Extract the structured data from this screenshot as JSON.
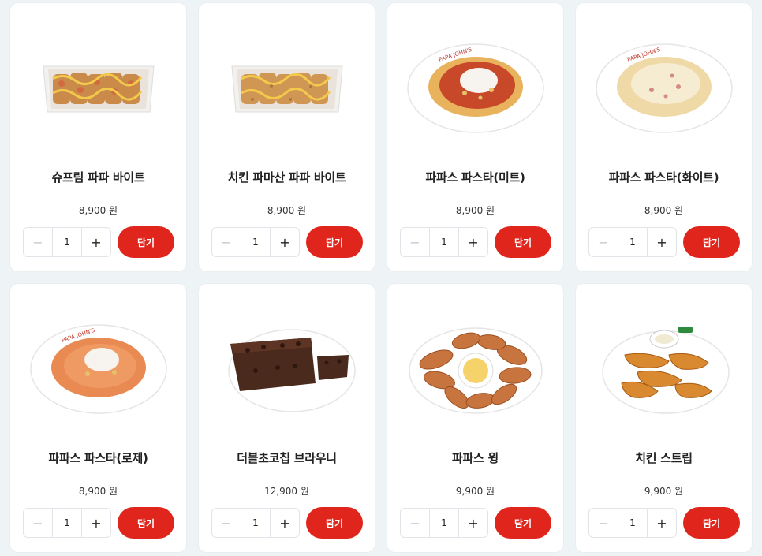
{
  "products": [
    {
      "name": "슈프림 파파 바이트",
      "price": "8,900 원",
      "qty": "1",
      "minus": "−",
      "plus": "+",
      "add_label": "담기",
      "image": "supreme-bite-tray"
    },
    {
      "name": "치킨 파마산 파파 바이트",
      "price": "8,900 원",
      "qty": "1",
      "minus": "−",
      "plus": "+",
      "add_label": "담기",
      "image": "chicken-parmesan-bite-tray"
    },
    {
      "name": "파파스 파스타(미트)",
      "price": "8,900 원",
      "qty": "1",
      "minus": "−",
      "plus": "+",
      "add_label": "담기",
      "image": "meat-pasta-plate"
    },
    {
      "name": "파파스 파스타(화이트)",
      "price": "8,900 원",
      "qty": "1",
      "minus": "−",
      "plus": "+",
      "add_label": "담기",
      "image": "white-pasta-plate"
    },
    {
      "name": "파파스 파스타(로제)",
      "price": "8,900 원",
      "qty": "1",
      "minus": "−",
      "plus": "+",
      "add_label": "담기",
      "image": "rose-pasta-plate"
    },
    {
      "name": "더블초코칩 브라우니",
      "price": "12,900 원",
      "qty": "1",
      "minus": "−",
      "plus": "+",
      "add_label": "담기",
      "image": "brownie-plate"
    },
    {
      "name": "파파스 윙",
      "price": "9,900 원",
      "qty": "1",
      "minus": "−",
      "plus": "+",
      "add_label": "담기",
      "image": "wings-plate"
    },
    {
      "name": "치킨 스트립",
      "price": "9,900 원",
      "qty": "1",
      "minus": "−",
      "plus": "+",
      "add_label": "담기",
      "image": "chicken-strips-plate"
    }
  ],
  "colors": {
    "accent": "#e0261c",
    "background": "#eef3f6",
    "card": "#ffffff"
  }
}
